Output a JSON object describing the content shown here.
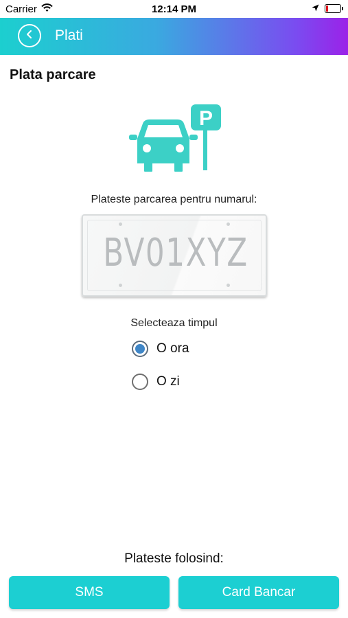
{
  "status_bar": {
    "carrier": "Carrier",
    "time": "12:14 PM",
    "battery_color": "#e0161d"
  },
  "nav": {
    "title": "Plati",
    "back_icon": "chevron-left-icon",
    "gradient": [
      "#1ccfcf",
      "#3aa9e0",
      "#7a4cf0",
      "#9b22e8"
    ]
  },
  "section": {
    "title": "Plata parcare"
  },
  "illustration": {
    "icon": "car-parking-icon",
    "sign_letter": "P",
    "color": "#3cd0c6"
  },
  "plate": {
    "label": "Plateste parcarea pentru numarul:",
    "number": "BV01XYZ"
  },
  "time_selection": {
    "label": "Selecteaza timpul",
    "options": [
      {
        "label": "O ora",
        "selected": true
      },
      {
        "label": "O zi",
        "selected": false
      }
    ]
  },
  "payment": {
    "label": "Plateste folosind:",
    "sms_label": "SMS",
    "card_label": "Card Bancar",
    "accent": "#1ccfd2"
  }
}
